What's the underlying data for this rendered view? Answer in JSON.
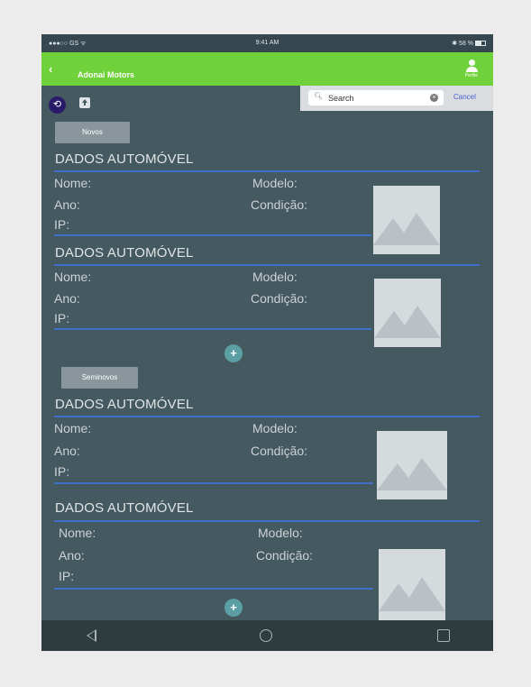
{
  "status_bar": {
    "carrier": "●●●○○ GS ᯤ",
    "time": "9:41 AM",
    "battery": "✱ 58 %"
  },
  "app_bar": {
    "back": "‹",
    "title": "Adonai Motors",
    "profile_label": "Perfile"
  },
  "search": {
    "value": "Search",
    "cancel": "Cancel"
  },
  "toolbar": {
    "back_icon": "⟲"
  },
  "sections": [
    {
      "label": "Novos"
    },
    {
      "label": "Seminovos"
    }
  ],
  "cards": [
    {
      "title": "DADOS AUTOMÓVEL",
      "nome": "Nome:",
      "modelo": "Modelo:",
      "ano": "Ano:",
      "condicao": "Condição:",
      "ip": "IP:"
    },
    {
      "title": "DADOS AUTOMÓVEL",
      "nome": "Nome:",
      "modelo": "Modelo:",
      "ano": "Ano:",
      "condicao": "Condição:",
      "ip": "IP:"
    },
    {
      "title": "DADOS AUTOMÓVEL",
      "nome": "Nome:",
      "modelo": "Modelo:",
      "ano": "Ano:",
      "condicao": "Condição:",
      "ip": "IP:"
    },
    {
      "title": "DADOS AUTOMÓVEL",
      "nome": "Nome:",
      "modelo": "Modelo:",
      "ano": "Ano:",
      "condicao": "Condição:",
      "ip": "IP:"
    }
  ],
  "fab_label": "+",
  "icons": [
    "signal-icon",
    "wifi-icon",
    "bluetooth-icon",
    "battery-icon",
    "back-chevron-icon",
    "profile-icon",
    "back-circle-icon",
    "share-icon",
    "search-icon",
    "clear-icon",
    "image-placeholder-icon",
    "add-icon",
    "nav-back-icon",
    "nav-home-icon",
    "nav-recent-icon"
  ],
  "colors": {
    "app_bar": "#6fd23b",
    "background": "#455a60",
    "rule": "#3f6fc8",
    "fab": "#5b9ea3",
    "nav_bar": "#2e3b3f"
  }
}
